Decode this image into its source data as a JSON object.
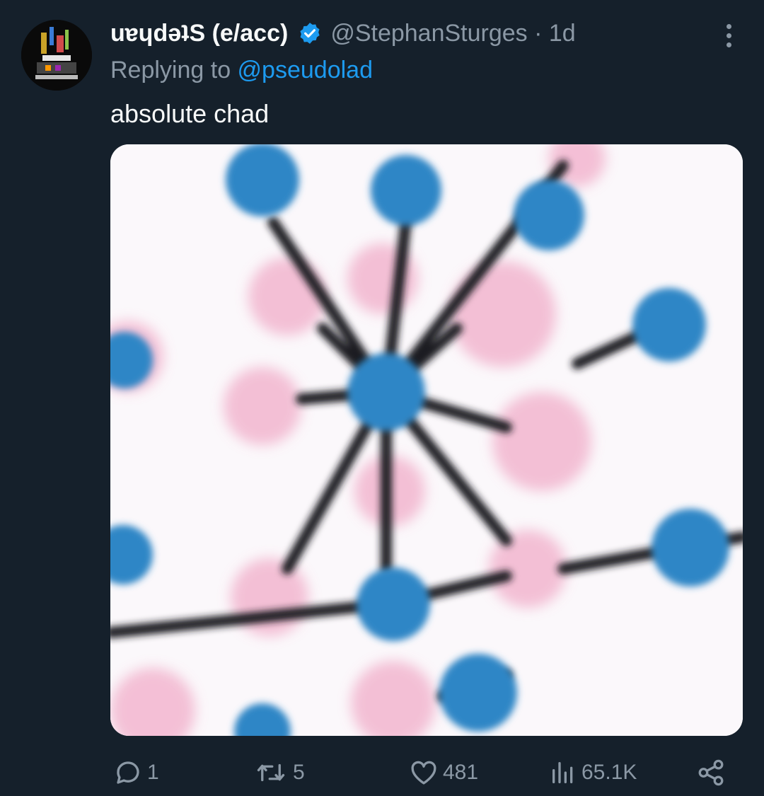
{
  "tweet": {
    "author_name": "uɐɥdǝʇS (e/acc)",
    "author_handle": "@StephanSturges · 1d",
    "reply_prefix": "Replying to ",
    "reply_to": "@pseudolad",
    "text": "absolute chad",
    "media_description": "molecule-like graphic with blue and pink circles connected by black lines"
  },
  "actions": {
    "replies": "1",
    "retweets": "5",
    "likes": "481",
    "views": "65.1K"
  },
  "icons": {
    "verified": "verified-badge-icon",
    "more": "more-options-icon",
    "reply": "reply-icon",
    "retweet": "retweet-icon",
    "like": "heart-icon",
    "views": "views-icon",
    "share": "share-icon"
  },
  "colors": {
    "background": "#15202b",
    "accent": "#1d9bf0",
    "muted": "#8b98a5",
    "text": "#f7f9f9",
    "molecule_blue": "#2e86c1",
    "molecule_pink": "#f0aac8"
  }
}
